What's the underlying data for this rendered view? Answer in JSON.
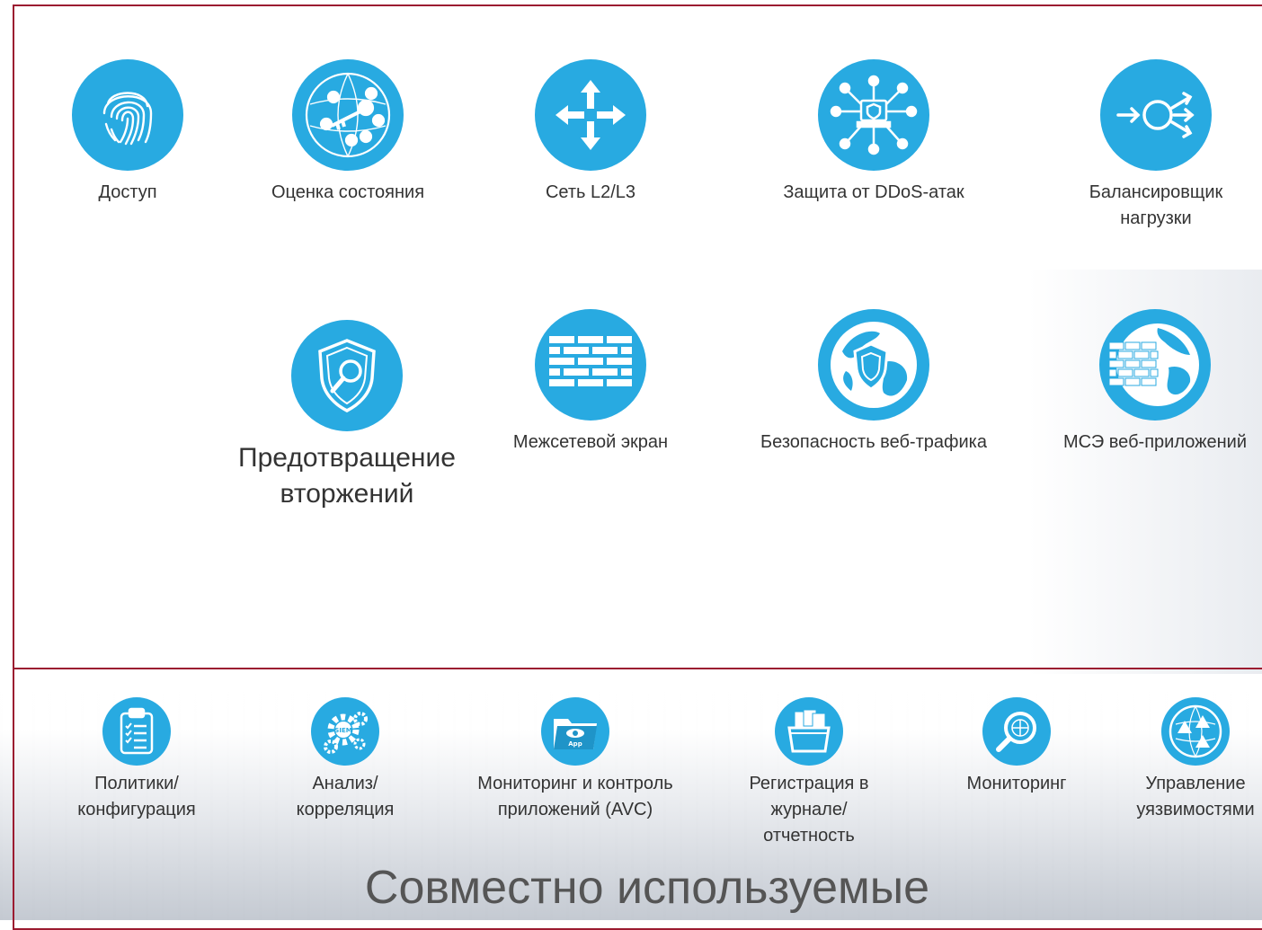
{
  "top_row": [
    {
      "label": "Доступ",
      "icon": "fingerprint-icon"
    },
    {
      "label": "Оценка состояния",
      "icon": "posture-globe-icon"
    },
    {
      "label": "Сеть L2/L3",
      "icon": "router-arrows-icon"
    },
    {
      "label": "Защита от DDoS-атак",
      "icon": "ddos-network-icon"
    },
    {
      "label": "Балансировщик нагрузки",
      "icon": "load-balancer-icon"
    }
  ],
  "middle_row": [
    {
      "label": "Предотвращение вторжений",
      "icon": "shield-magnifier-icon"
    },
    {
      "label": "Межсетевой экран",
      "icon": "brick-wall-icon"
    },
    {
      "label": "Безопасность веб-трафика",
      "icon": "globe-shield-icon"
    },
    {
      "label": "МСЭ веб-приложений",
      "icon": "globe-wall-icon"
    }
  ],
  "bottom_row": [
    {
      "label": "Политики/ конфигурация",
      "icon": "clipboard-icon"
    },
    {
      "label": "Анализ/ корреляция",
      "icon": "siem-gears-icon"
    },
    {
      "label": "Мониторинг и контроль приложений (AVC)",
      "icon": "app-folder-eye-icon"
    },
    {
      "label": "Регистрация в журнале/ отчетность",
      "icon": "documents-box-icon"
    },
    {
      "label": "Мониторинг",
      "icon": "magnifier-globe-icon"
    },
    {
      "label": "Управление уязвимостями",
      "icon": "vulnerability-globe-icon"
    }
  ],
  "section_title": "Совместно используемые",
  "colors": {
    "icon_blue": "#28aae1",
    "frame_red": "#9b1b30"
  }
}
